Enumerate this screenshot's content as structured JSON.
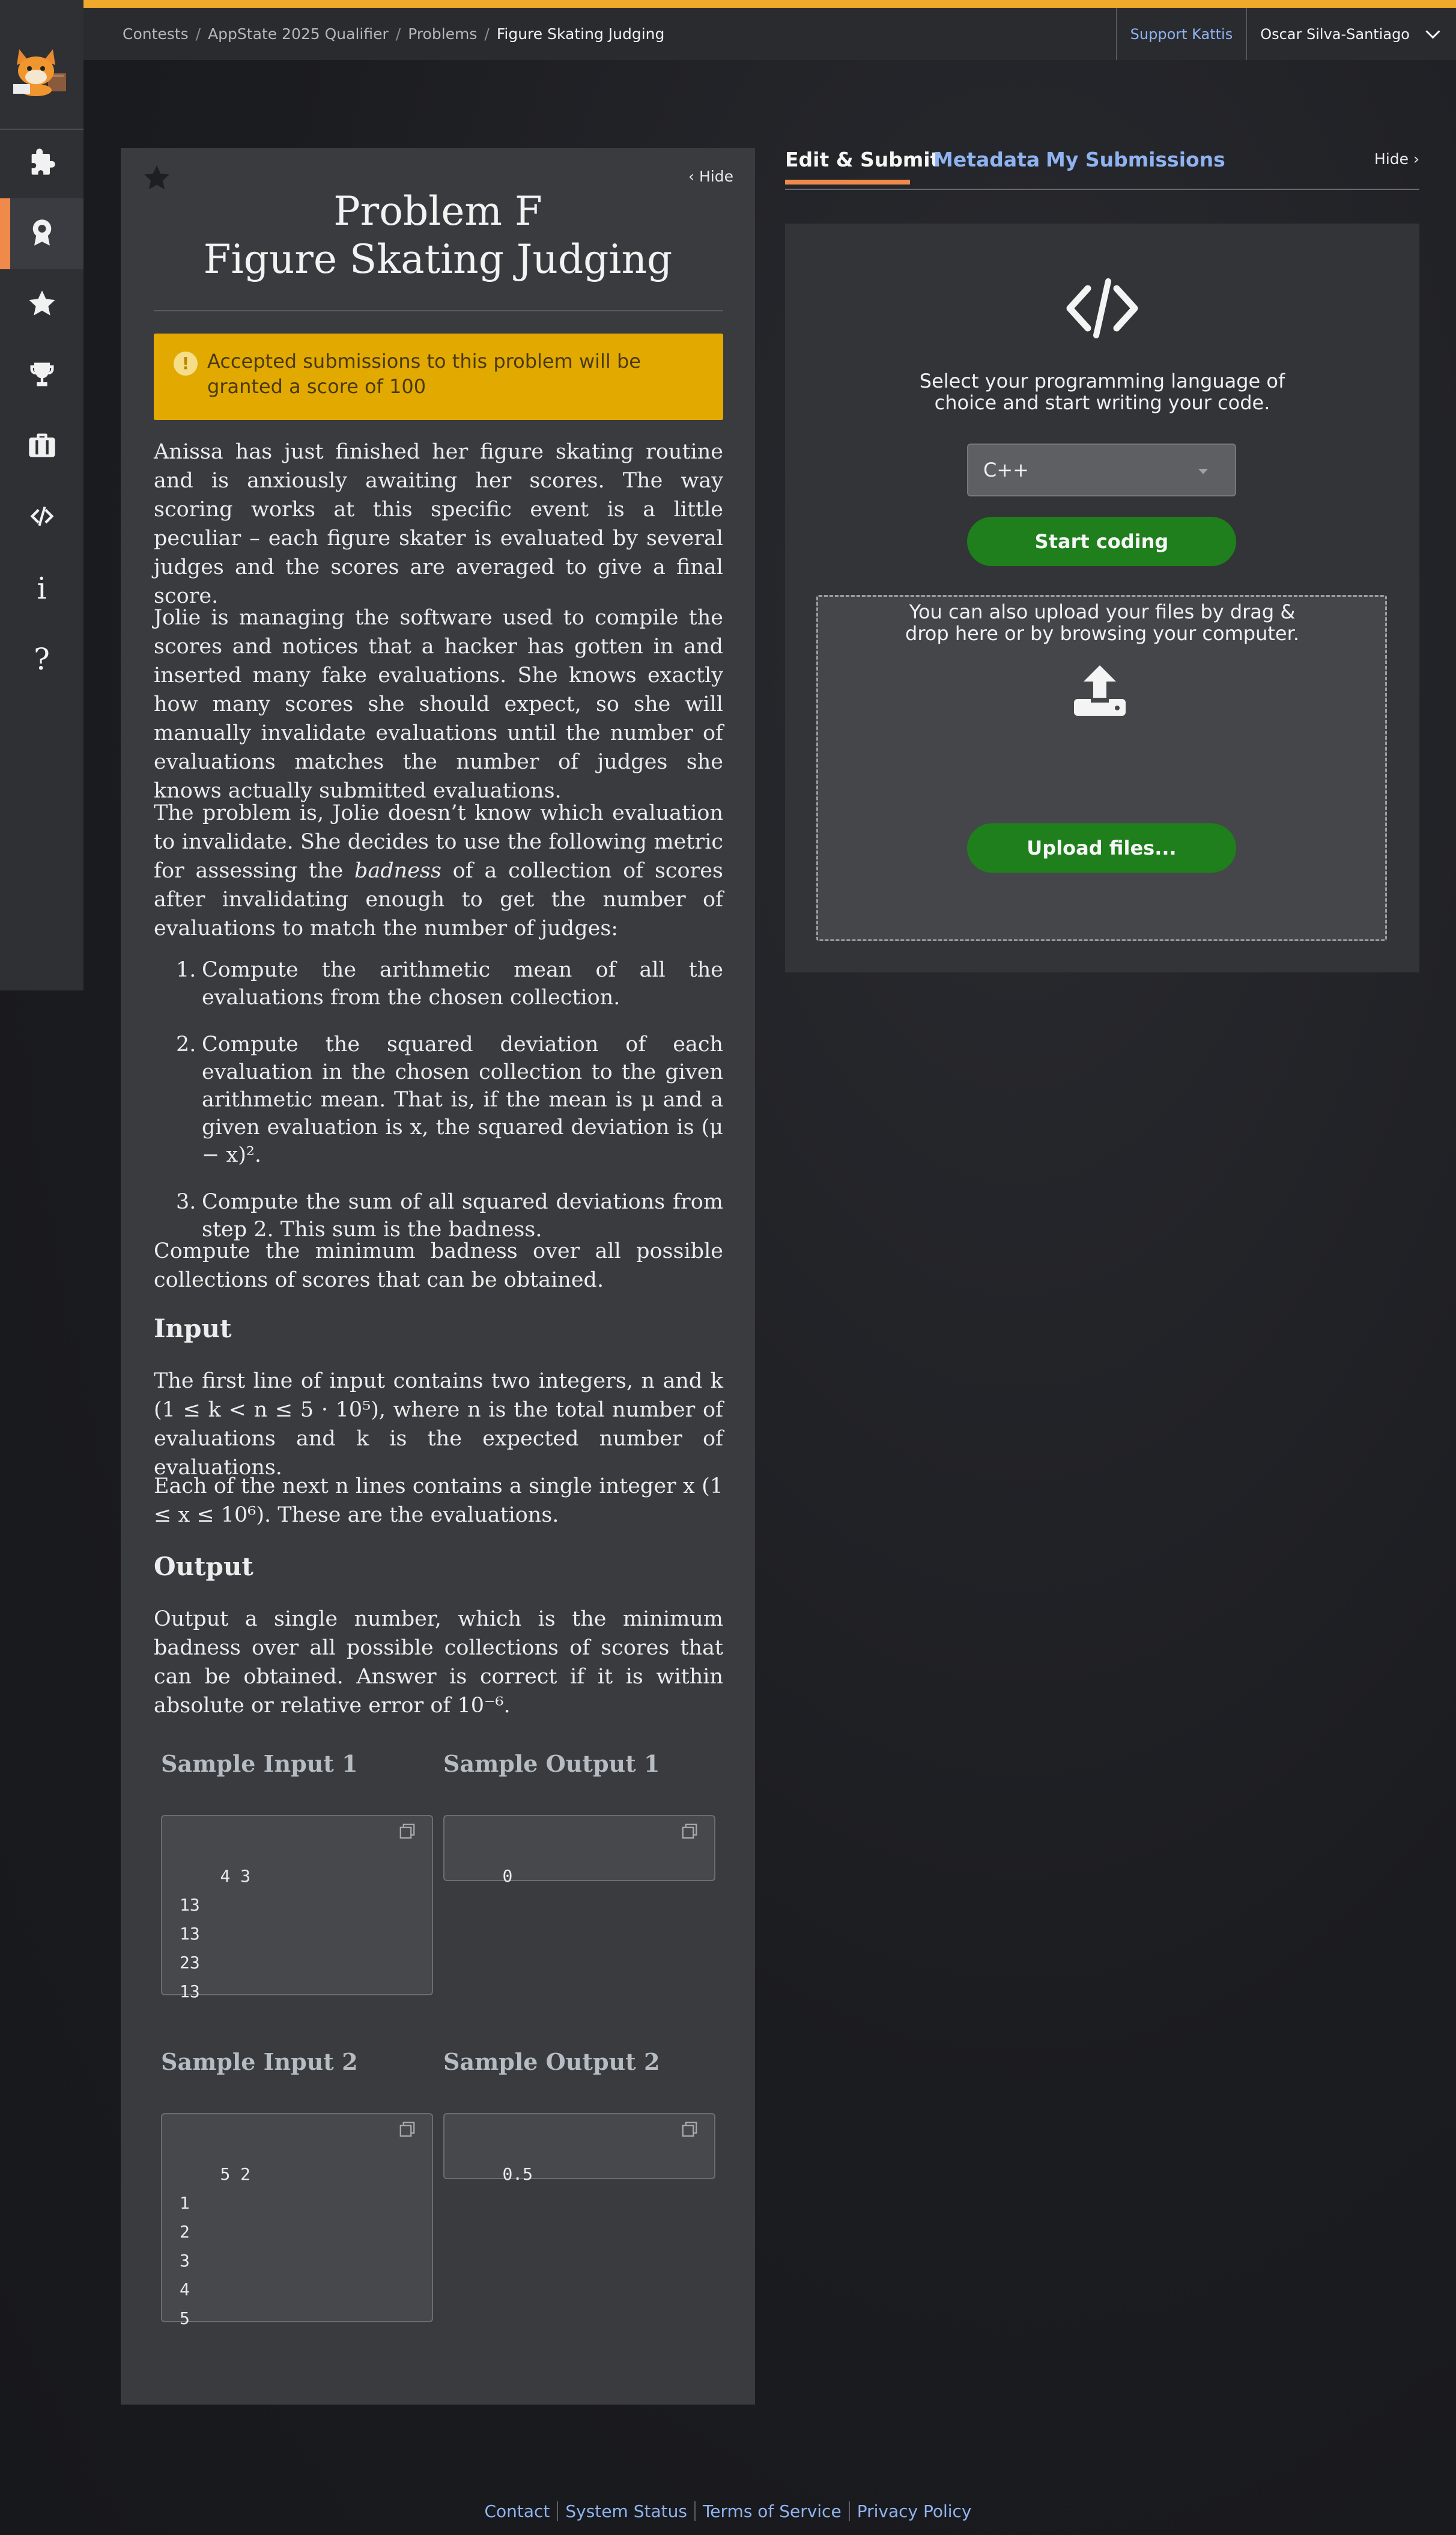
{
  "breadcrumbs": [
    "Contests",
    "AppState 2025 Qualifier",
    "Problems",
    "Figure Skating Judging"
  ],
  "topbar": {
    "support_label": "Support Kattis",
    "user_name": "Oscar Silva-Santiago"
  },
  "sidebar": {
    "items": [
      "puzzle-icon",
      "badge-icon",
      "star-icon",
      "trophy-icon",
      "briefcase-icon",
      "code-icon",
      "info-icon",
      "help-icon"
    ],
    "active_index": 1,
    "info_glyph": "i",
    "help_glyph": "?"
  },
  "problem": {
    "hide_label": "Hide",
    "title_line1": "Problem F",
    "title_line2": "Figure Skating Judging",
    "notice": "Accepted submissions to this problem will be granted a score of 100",
    "para1": "Anissa has just finished her figure skating routine and is anxiously awaiting her scores. The way scoring works at this specific event is a little peculiar – each figure skater is evaluated by several judges and the scores are averaged to give a final score.",
    "para2": "Jolie is managing the software used to compile the scores and notices that a hacker has gotten in and inserted many fake evaluations. She knows exactly how many scores she should expect, so she will manually invalidate evaluations until the number of evaluations matches the number of judges she knows actually submitted evaluations.",
    "para3_a": "The problem is, Jolie doesn’t know which evaluation to invalidate. She decides to use the following metric for assessing the ",
    "para3_em": "badness",
    "para3_b": " of a collection of scores after invalidating enough to get the number of evaluations to match the number of judges:",
    "steps": [
      "Compute the arithmetic mean of all the evaluations from the chosen collection.",
      "Compute the squared deviation of each evaluation in the chosen collection to the given arithmetic mean. That is, if the mean is μ and a given evaluation is x, the squared deviation is (μ − x)².",
      "Compute the sum of all squared deviations from step 2. This sum is the badness."
    ],
    "para4": "Compute the minimum badness over all possible collections of scores that can be obtained.",
    "input_heading": "Input",
    "input_p1": "The first line of input contains two integers, n and k (1 ≤ k < n ≤ 5 · 10⁵), where n is the total number of evaluations and k is the expected number of evaluations.",
    "input_p2": "Each of the next n lines contains a single integer x (1 ≤ x ≤ 10⁶). These are the evaluations.",
    "output_heading": "Output",
    "output_p": "Output a single number, which is the minimum badness over all possible collections of scores that can be obtained. Answer is correct if it is within absolute or relative error of 10⁻⁶.",
    "samples": [
      {
        "in_label": "Sample Input 1",
        "out_label": "Sample Output 1",
        "input": "4 3\n13\n13\n23\n13",
        "output": "0"
      },
      {
        "in_label": "Sample Input 2",
        "out_label": "Sample Output 2",
        "input": "5 2\n1\n2\n3\n4\n5",
        "output": "0.5"
      }
    ]
  },
  "tabs": [
    "Edit & Submit",
    "Metadata",
    "My Submissions"
  ],
  "active_tab": "Edit & Submit",
  "right_hide_label": "Hide",
  "submit": {
    "select_msg_1": "Select your programming language of",
    "select_msg_2": "choice and start writing your code.",
    "language": "C++",
    "start_label": "Start coding",
    "upload_msg_1": "You can also upload your files by drag &",
    "upload_msg_2": "drop here or by browsing your computer.",
    "upload_label": "Upload files..."
  },
  "footer": [
    "Contact",
    "System Status",
    "Terms of Service",
    "Privacy Policy"
  ],
  "colors": {
    "accent": "#f08a4b",
    "notice": "#e2a900",
    "link": "#8fb3f0",
    "button": "#1e7f1c"
  }
}
